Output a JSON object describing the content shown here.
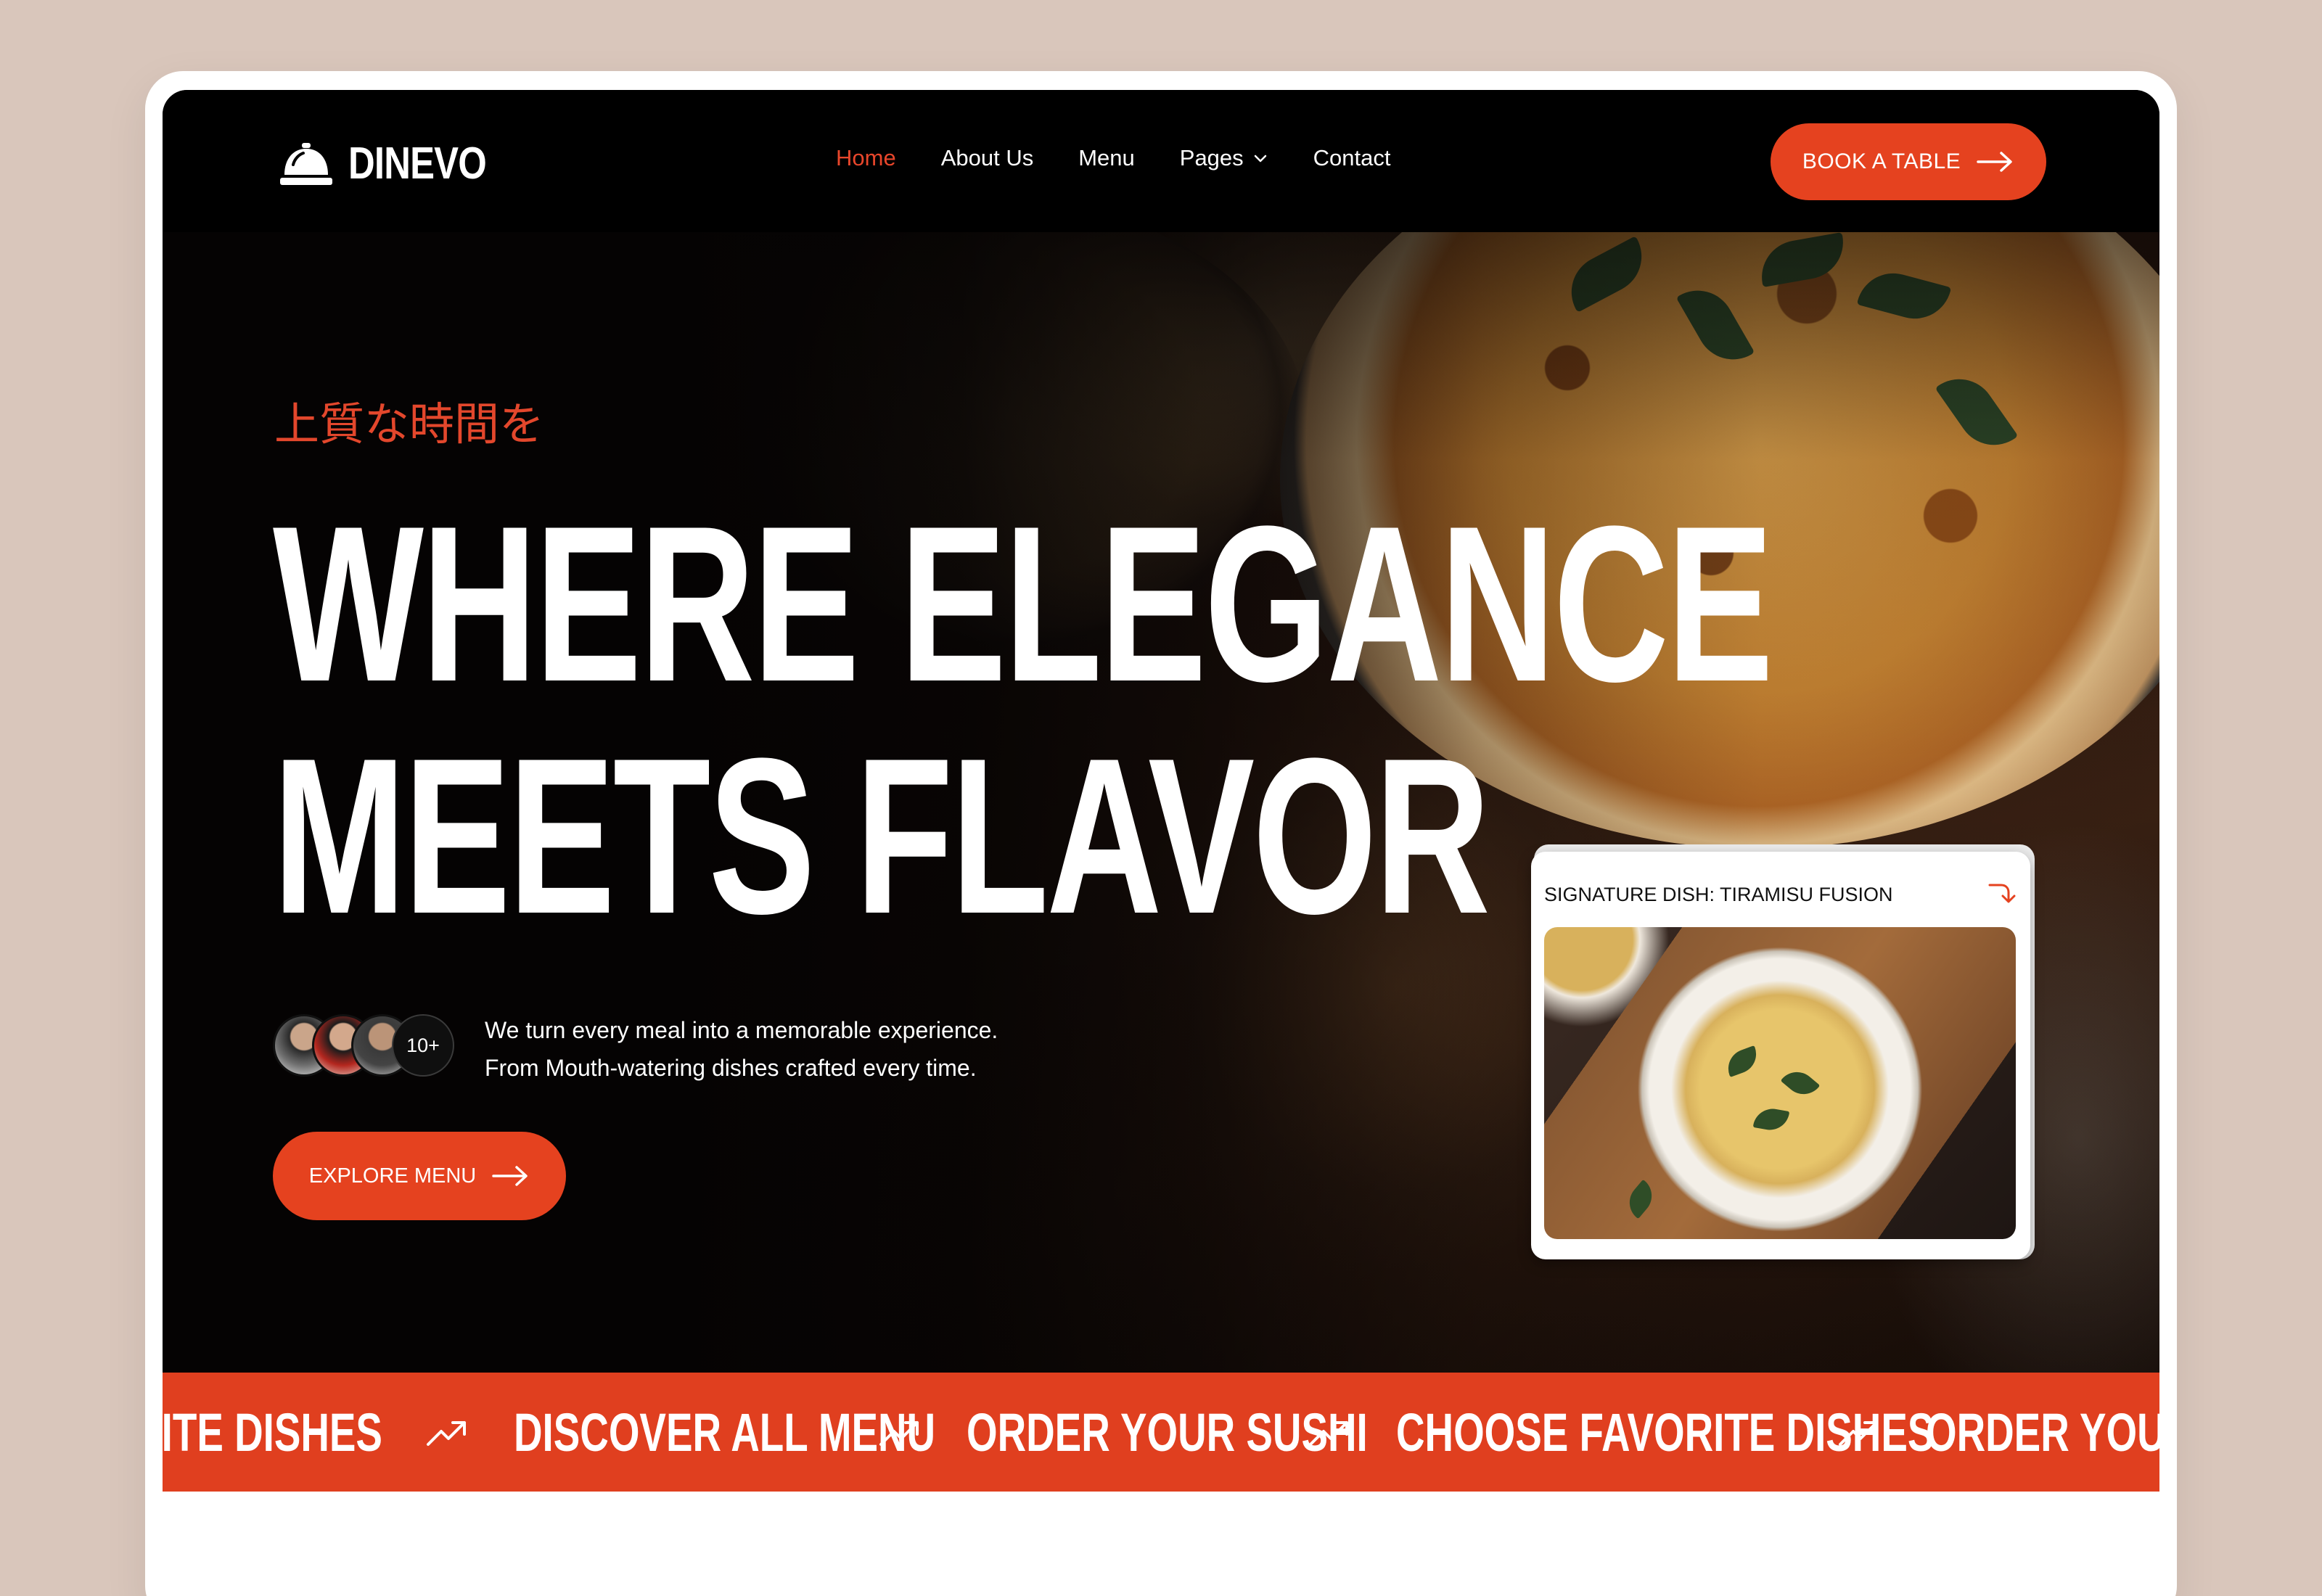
{
  "nav": {
    "logo_text": "DINEVO",
    "items": [
      {
        "label": "Home",
        "active": true
      },
      {
        "label": "About Us"
      },
      {
        "label": "Menu"
      },
      {
        "label": "Pages",
        "has_dropdown": true
      },
      {
        "label": "Contact"
      }
    ],
    "cta_label": "BOOK A TABLE"
  },
  "hero": {
    "kicker": "上質な時間を",
    "headline_line1": "WHERE ELEGANCE",
    "headline_line2": "MEETS FLAVOR",
    "avatar_count": "10+",
    "tagline_line1": "We turn every meal into a memorable experience.",
    "tagline_line2": "From Mouth-watering dishes crafted every time.",
    "explore_label": "EXPLORE MENU"
  },
  "signature_card": {
    "title": "SIGNATURE DISH: TIRAMISU FUSION"
  },
  "marquee": {
    "items": [
      "VORITE DISHES",
      "DISCOVER ALL MENU",
      "ORDER YOUR SUSHI",
      "CHOOSE FAVORITE DISHES",
      "ORDER YOUR S"
    ]
  },
  "colors": {
    "accent": "#e5421f",
    "nav_bg": "#000000",
    "page_bg": "#d9c6bb"
  },
  "icons": {
    "logo": "service-bell-icon",
    "button_arrow": "arrow-right-icon",
    "card_arrow": "arrow-down-right-icon",
    "marquee": "trending-up-icon",
    "dropdown": "chevron-down-icon"
  }
}
